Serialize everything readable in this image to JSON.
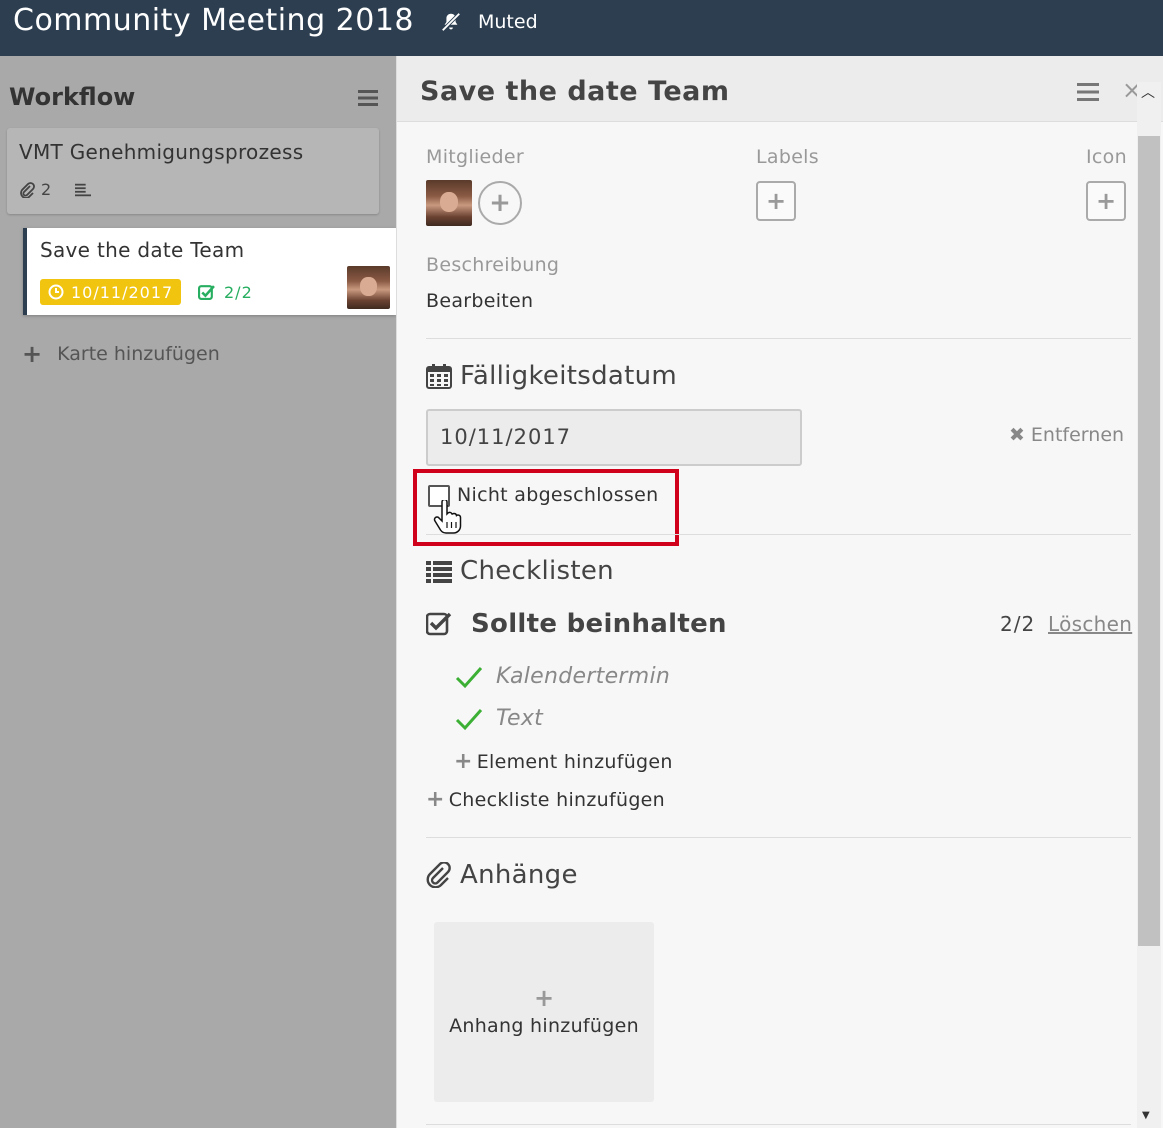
{
  "header": {
    "board_title": "Community Meeting 2018",
    "muted_label": "Muted",
    "muted_icon": "bell-slash-icon"
  },
  "list": {
    "title": "Workflow",
    "cards": [
      {
        "title": "VMT Genehmigungsprozess",
        "attachments_count": "2"
      },
      {
        "title": "Save the date Team",
        "due_date": "10/11/2017",
        "checklist_progress": "2/2"
      }
    ],
    "add_card_label": "Karte hinzufügen"
  },
  "panel": {
    "title": "Save the date Team",
    "members_label": "Mitglieder",
    "labels_label": "Labels",
    "icon_label": "Icon",
    "description_label": "Beschreibung",
    "description_edit": "Bearbeiten",
    "due_section": {
      "title": "Fälligkeitsdatum",
      "date_value": "10/11/2017",
      "remove_label": "Entfernen",
      "not_done_label": "Nicht abgeschlossen",
      "completed": false
    },
    "checklists_section": {
      "title": "Checklisten",
      "checklist": {
        "name": "Sollte beinhalten",
        "count": "2/2",
        "delete_label": "Löschen",
        "items": [
          {
            "text": "Kalendertermin",
            "done": true
          },
          {
            "text": "Text",
            "done": true
          }
        ],
        "add_item_label": "Element hinzufügen"
      },
      "add_checklist_label": "Checkliste hinzufügen"
    },
    "attachments_section": {
      "title": "Anhänge",
      "add_label": "Anhang hinzufügen"
    }
  },
  "colors": {
    "header_bg": "#2c3e50",
    "due_badge": "#f1c40f",
    "checklist_green": "#27ae60",
    "highlight_red": "#d0021b"
  }
}
